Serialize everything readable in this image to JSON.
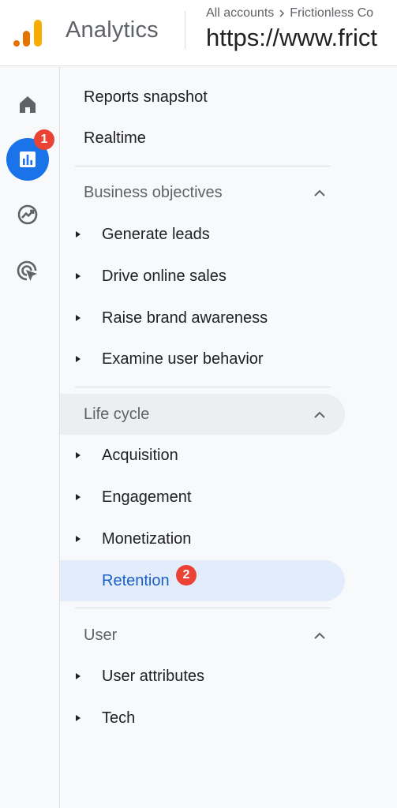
{
  "header": {
    "app_name": "Analytics",
    "breadcrumb": [
      "All accounts",
      "Frictionless Co"
    ],
    "property": "https://www.frict"
  },
  "rail": {
    "items": [
      {
        "name": "home",
        "icon": "home-icon"
      },
      {
        "name": "reports",
        "icon": "bar-chart-icon",
        "active": true,
        "badge": "1"
      },
      {
        "name": "explore",
        "icon": "explore-trend-icon"
      },
      {
        "name": "advertising",
        "icon": "target-cursor-icon"
      }
    ]
  },
  "nav": {
    "reports_snapshot": "Reports snapshot",
    "realtime": "Realtime",
    "business_objectives": {
      "title": "Business objectives",
      "items": [
        "Generate leads",
        "Drive online sales",
        "Raise brand awareness",
        "Examine user behavior"
      ]
    },
    "life_cycle": {
      "title": "Life cycle",
      "items": [
        "Acquisition",
        "Engagement",
        "Monetization"
      ],
      "selected": "Retention",
      "selected_badge": "2"
    },
    "user": {
      "title": "User",
      "items": [
        "User attributes",
        "Tech"
      ]
    }
  },
  "colors": {
    "accent": "#1a73e8",
    "badge": "#ea4335",
    "selected_bg": "#e3ecfb",
    "logo_orange": "#f9ab00",
    "logo_dark_orange": "#e37400"
  }
}
